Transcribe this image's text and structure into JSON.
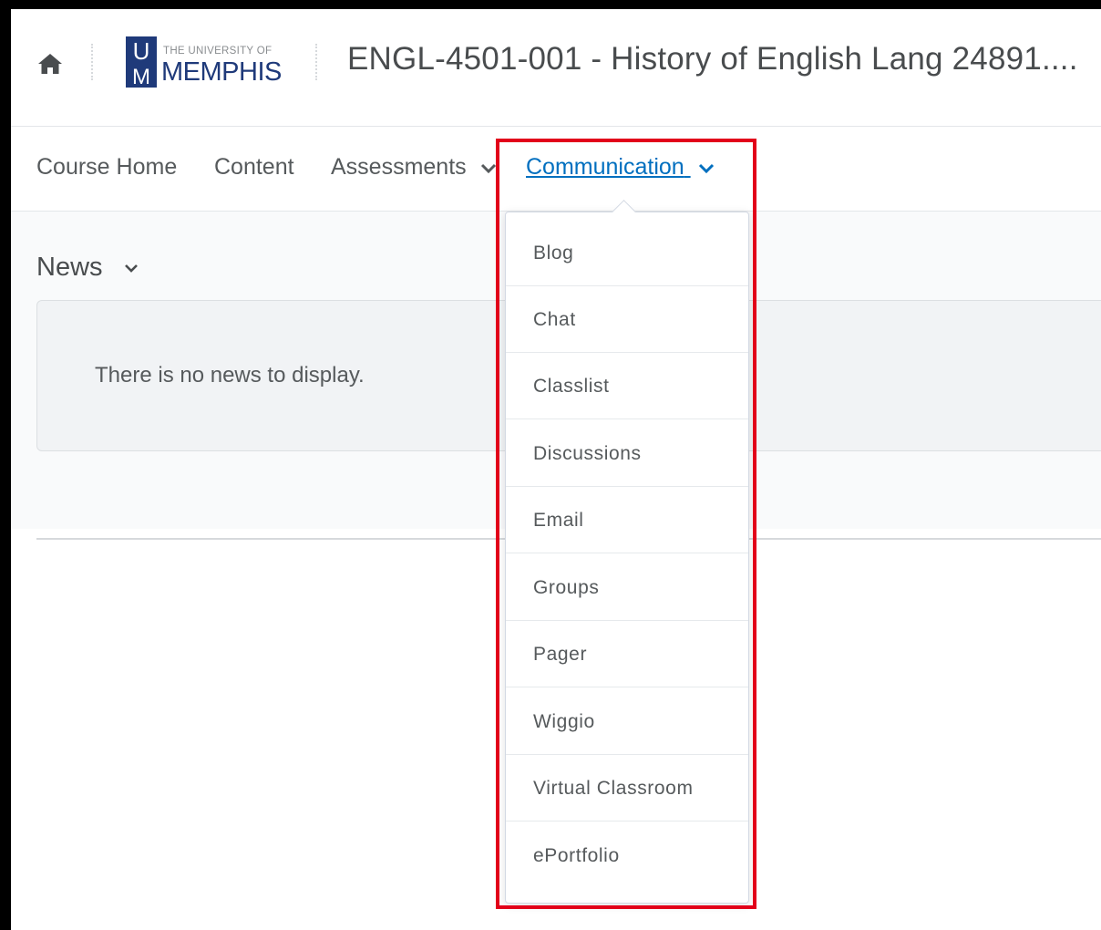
{
  "header": {
    "home_icon": "home-icon",
    "logo": {
      "monogram_top": "U",
      "monogram_bottom": "M",
      "small_text": "THE UNIVERSITY OF",
      "big_text": "MEMPHIS",
      "color": "#1f3a7a"
    },
    "course_title": "ENGL-4501-001 - History of English Lang 24891...."
  },
  "nav": {
    "items": [
      {
        "label": "Course Home"
      },
      {
        "label": "Content"
      },
      {
        "label": "Assessments",
        "has_dropdown": true
      },
      {
        "label": "Communication",
        "has_dropdown": true,
        "active": true
      }
    ],
    "active_color": "#006fbf"
  },
  "news": {
    "title": "News",
    "empty_message": "There is no news to display."
  },
  "dropdown": {
    "items": [
      {
        "label": "Blog"
      },
      {
        "label": "Chat"
      },
      {
        "label": "Classlist"
      },
      {
        "label": "Discussions"
      },
      {
        "label": "Email"
      },
      {
        "label": "Groups"
      },
      {
        "label": "Pager"
      },
      {
        "label": "Wiggio"
      },
      {
        "label": "Virtual Classroom"
      },
      {
        "label": "ePortfolio"
      }
    ]
  },
  "highlight_color": "#e2001a"
}
